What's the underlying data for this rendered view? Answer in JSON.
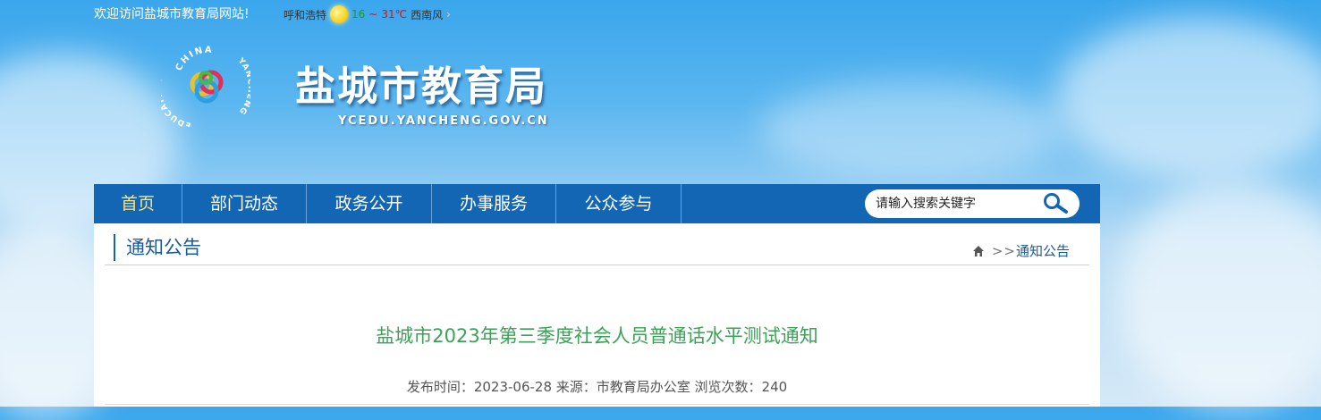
{
  "topbar": {
    "welcome": "欢迎访问盐城市教育局网站!",
    "city": "呼和浩特",
    "temp_low": "16",
    "temp_sep": "~",
    "temp_high": "31℃",
    "wind": "西南风",
    "weather_icon": "sun-icon"
  },
  "header": {
    "title": "盐城市教育局",
    "domain": "YCEDU.YANCHENG.GOV.CN",
    "logo_text_top": "CHINA",
    "logo_text_left": "EDUCATION",
    "logo_text_right": "YANCHENG"
  },
  "nav": {
    "items": [
      {
        "label": "首页",
        "active": true
      },
      {
        "label": "部门动态"
      },
      {
        "label": "政务公开"
      },
      {
        "label": "办事服务"
      },
      {
        "label": "公众参与"
      }
    ],
    "search_placeholder": "请输入搜索关键字"
  },
  "section": {
    "title": "通知公告",
    "breadcrumb_sep": ">>",
    "breadcrumb_current": "通知公告"
  },
  "article": {
    "title": "盐城市2023年第三季度社会人员普通话水平测试通知",
    "meta": "发布时间：2023-06-28 来源：市教育局办公室 浏览次数：240"
  },
  "colors": {
    "nav_bg": "#1366b4",
    "nav_active": "#ffe27a",
    "title_green": "#3aa356",
    "section_blue": "#1a5a9a"
  }
}
